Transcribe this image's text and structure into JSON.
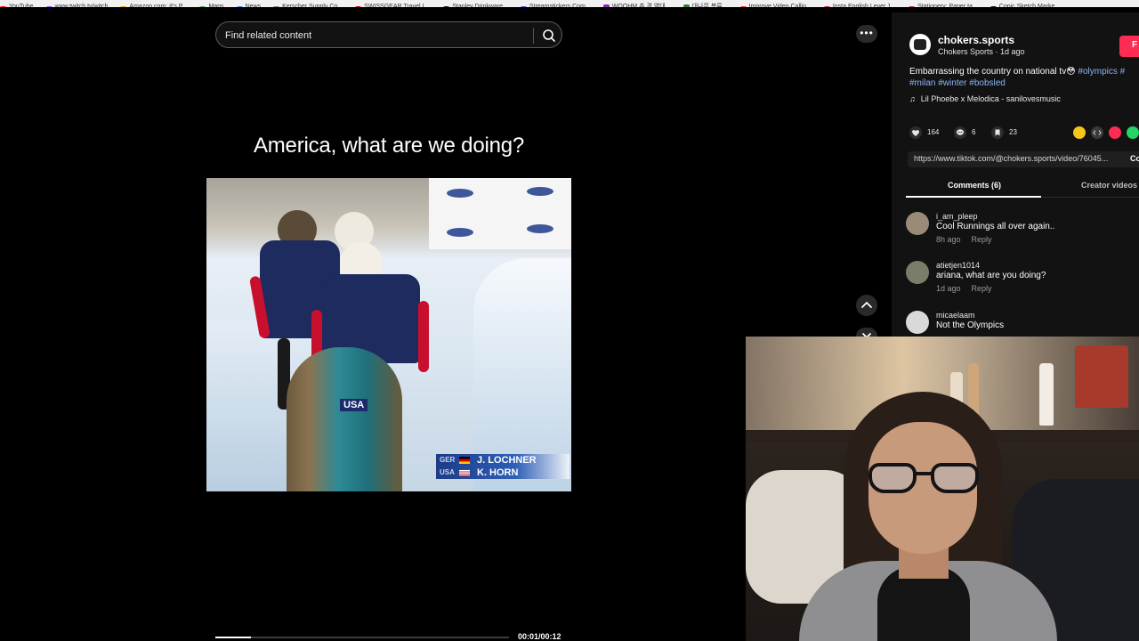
{
  "bookmarks": [
    {
      "label": "YouTube",
      "color": "#ff0000"
    },
    {
      "label": "www.twitch.tv/witch",
      "color": "#9146ff"
    },
    {
      "label": "Amazon.com: It's P...",
      "color": "#ff9900"
    },
    {
      "label": "Maps",
      "color": "#34a853"
    },
    {
      "label": "News",
      "color": "#4285f4"
    },
    {
      "label": "Kerscher Supply Co...",
      "color": "#777777"
    },
    {
      "label": "SWISSGEAR Travel L...",
      "color": "#d0021b"
    },
    {
      "label": "Stanley Drinkware...",
      "color": "#222222"
    },
    {
      "label": "Streamstickers Com...",
      "color": "#7b3fe4"
    },
    {
      "label": "WOOHM 추 경 역대...",
      "color": "#8e24aa"
    },
    {
      "label": "대나무 분류...",
      "color": "#2e7d32"
    },
    {
      "label": "Improve Video Callin...",
      "color": "#e53935"
    },
    {
      "label": "Insta English Lever 1...",
      "color": "#c2185b"
    },
    {
      "label": "Stationery: Paper ta...",
      "color": "#d32f2f"
    },
    {
      "label": "Copic Sketch Marke...",
      "color": "#111111"
    }
  ],
  "video": {
    "search_placeholder": "Find related content",
    "caption": "America, what are we doing?",
    "lower_third": [
      {
        "code": "GER",
        "name": "J. LOCHNER"
      },
      {
        "code": "USA",
        "name": "K. HORN"
      }
    ],
    "sled_label": "USA",
    "time": "00:01/00:12",
    "progress": 0.12
  },
  "controls": {
    "more": "•••"
  },
  "author": {
    "username": "chokers.sports",
    "meta": "Chokers Sports · 1d ago",
    "follow": "F"
  },
  "description": {
    "text": "Embarrassing the country on national tv",
    "emoji": "😳",
    "tags_line1": "#olympics #",
    "tags_line2": [
      "#milan",
      "#winter",
      "#bobsled"
    ]
  },
  "music": {
    "icon": "♫",
    "title": "Lil Phoebe x Melodica - sanilovesmusic"
  },
  "stats": {
    "likes": "164",
    "comments": "6",
    "saves": "23"
  },
  "share_colors": [
    "#f5c518",
    "#3a3a3a",
    "#fe2c55",
    "#25d366"
  ],
  "link": {
    "url": "https://www.tiktok.com/@chokers.sports/video/76045...",
    "copy": "Co"
  },
  "tabs": [
    {
      "label": "Comments (6)",
      "active": true
    },
    {
      "label": "Creator videos",
      "active": false
    }
  ],
  "comments": [
    {
      "user": "i_am_pleep",
      "text": "Cool Runnings all over again..",
      "time": "8h ago",
      "reply": "Reply",
      "avatar_color": "#9a8a78"
    },
    {
      "user": "atietjen1014",
      "text": "ariana, what are you doing?",
      "time": "1d ago",
      "reply": "Reply",
      "avatar_color": "#7b7d6a"
    },
    {
      "user": "micaelaam",
      "text": "Not the Olympics",
      "time": "",
      "reply": "",
      "avatar_color": "#d9d9d9"
    }
  ]
}
